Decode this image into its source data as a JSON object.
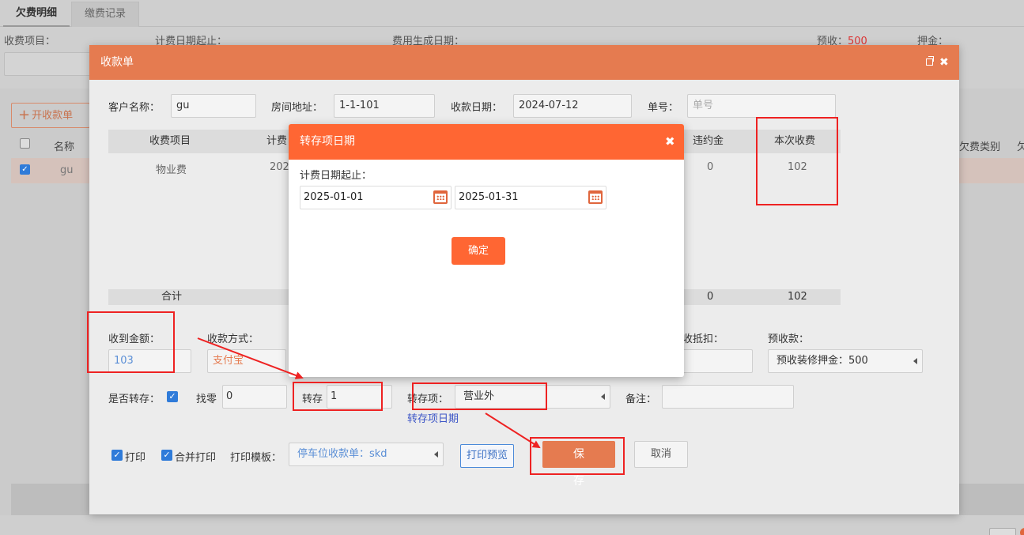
{
  "background": {
    "tabs": [
      "欠费明细",
      "缴费记录"
    ],
    "filter_labels": {
      "charge_item": "收费项目：",
      "billing_period": "计费日期起止：",
      "generated_date": "费用生成日期：",
      "prepaid_label": "预收：",
      "prepaid_value": "500",
      "deposit_label": "押金："
    },
    "open_receipt_label": "开收款单",
    "table_name_header": "名称",
    "row_name": "gu",
    "right_headers": [
      "欠费类别",
      "欠"
    ]
  },
  "dialog": {
    "title": "收款单",
    "customer_label": "客户名称：",
    "customer_value": "gu",
    "room_label": "房间地址：",
    "room_value": "1-1-101",
    "date_label": "收款日期：",
    "date_value": "2024-07-12",
    "no_label": "单号：",
    "no_placeholder": "单号",
    "table": {
      "headers": [
        "收费项目",
        "计费",
        "违约金",
        "本次收费"
      ],
      "row": [
        "物业费",
        "202",
        "0",
        "102"
      ],
      "sum_label": "合计",
      "sum_penalty": "0",
      "sum_current": "102"
    },
    "received_label": "收到金额：",
    "received_value": "103",
    "pay_method_label": "收款方式：",
    "pay_method_value": "支付宝",
    "offset_label": "收抵扣：",
    "prepay_label": "预收款：",
    "prepay_value": "预收装修押金：500",
    "transfer_label": "是否转存：",
    "change_label": "找零",
    "change_value": "0",
    "transfer_amount_label": "转存",
    "transfer_amount_value": "1",
    "transfer_item_label": "转存项：",
    "transfer_item_value": "营业外",
    "transfer_date_link": "转存项日期",
    "remark_label": "备注：",
    "print_label": "打印",
    "merge_print_label": "合并打印",
    "template_label": "打印模板：",
    "template_value": "停车位收款单：skd",
    "preview_label": "打印预览",
    "save_label": "保  存",
    "cancel_label": "取消"
  },
  "modal": {
    "title": "转存项日期",
    "period_label": "计费日期起止：",
    "start_date": "2025-01-01",
    "end_date": "2025-01-31",
    "ok_label": "确定"
  },
  "colors": {
    "dialog_header": "#e57b50",
    "modal_header": "#ff6633",
    "annotation": "#ee2222",
    "link": "#3b54c6"
  }
}
